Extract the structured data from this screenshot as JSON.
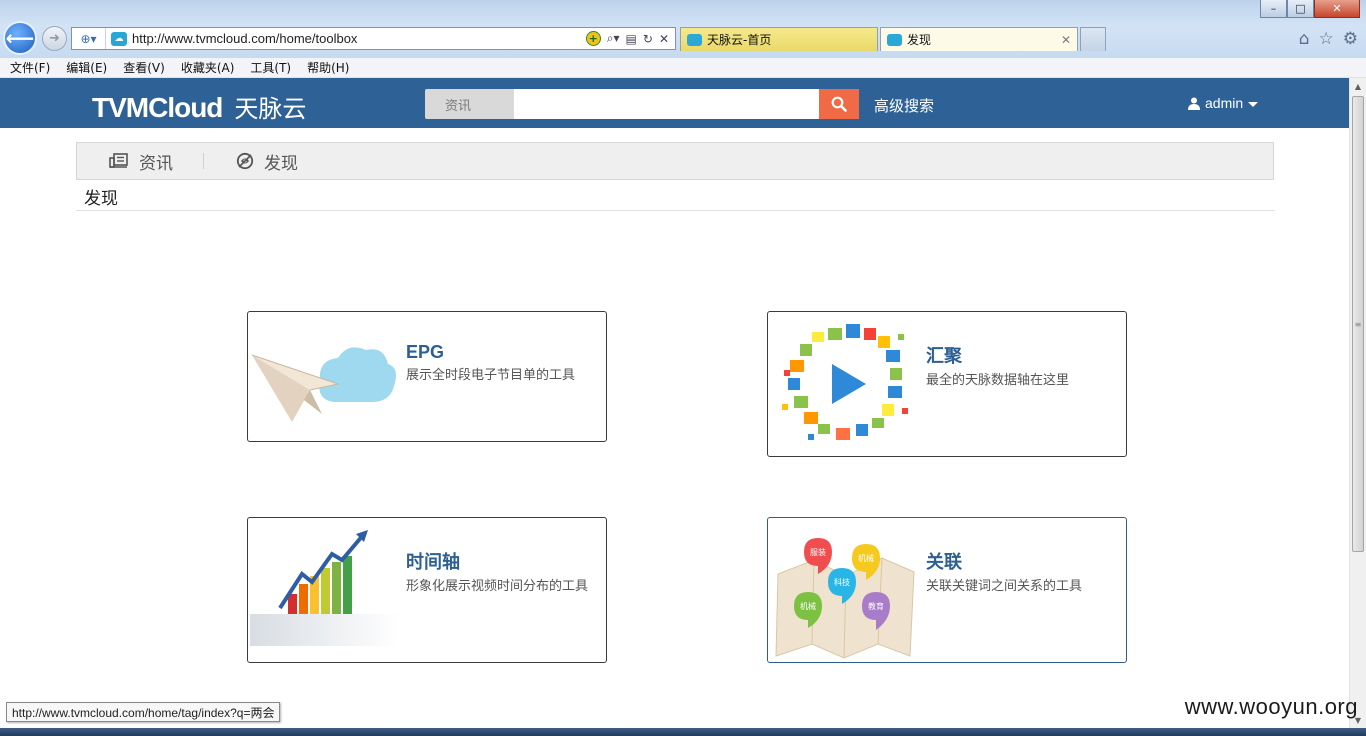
{
  "window": {
    "controls": {
      "minimize": "–",
      "maximize": "□",
      "close": "✕"
    }
  },
  "browser": {
    "address_url": "http://www.tvmcloud.com/home/toolbox",
    "tabs": [
      {
        "label": "天脉云-首页",
        "active": false
      },
      {
        "label": "发现",
        "active": true,
        "close": "✕"
      }
    ],
    "menu": [
      "文件(F)",
      "编辑(E)",
      "查看(V)",
      "收藏夹(A)",
      "工具(T)",
      "帮助(H)"
    ],
    "status_url": "http://www.tvmcloud.com/home/tag/index?q=两会"
  },
  "site": {
    "logo_latin": "TVMCloud",
    "logo_cn": "天脉云",
    "search_category": "资讯",
    "search_placeholder": "",
    "advanced_search": "高级搜索",
    "user": "admin",
    "brand_color": "#2e6196",
    "search_button_color": "#f06a45"
  },
  "subnav": {
    "items": [
      {
        "label": "资讯",
        "icon": "news-icon"
      },
      {
        "label": "发现",
        "icon": "discover-icon"
      }
    ]
  },
  "page": {
    "title": "发现",
    "cards": [
      {
        "title": "EPG",
        "desc": "展示全时段电子节目单的工具",
        "image": "paper-plane-cloud"
      },
      {
        "title": "汇聚",
        "desc": "最全的天脉数据轴在这里",
        "image": "play-ring"
      },
      {
        "title": "时间轴",
        "desc": "形象化展示视频时间分布的工具",
        "image": "growth-bar-chart"
      },
      {
        "title": "关联",
        "desc": "关联关键词之间关系的工具",
        "image": "map-pins",
        "pins": [
          "服装",
          "机械",
          "科技",
          "机械",
          "教育"
        ]
      }
    ]
  },
  "watermark": "www.wooyun.org"
}
